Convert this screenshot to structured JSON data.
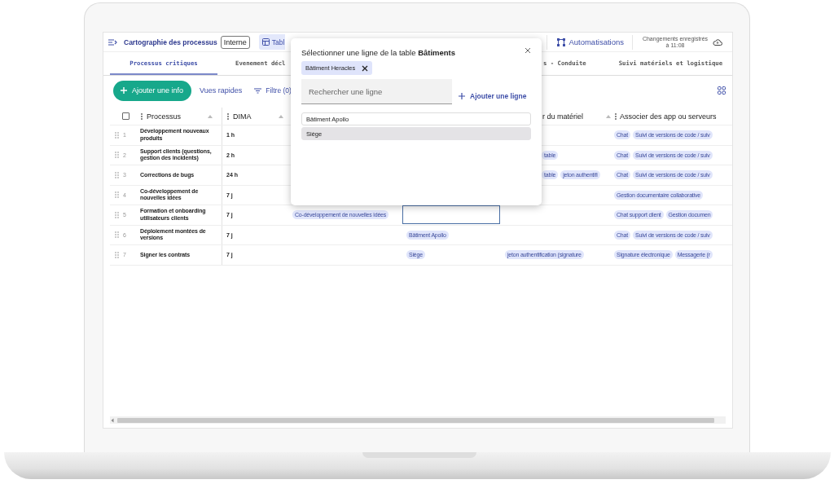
{
  "topbar": {
    "title": "Cartographie des processus",
    "badge": "Interne",
    "view_tab": "Tabl",
    "automations_tab": "Automatisations",
    "save_status": "Changements enregistrés à 11:08"
  },
  "tabs": [
    {
      "label": "Processus critiques",
      "selected": true
    },
    {
      "label": "Evenement décl",
      "selected": false
    },
    {
      "label": "s - Conduite",
      "selected": false
    },
    {
      "label": "Suivi matériels et logistique",
      "selected": false
    }
  ],
  "toolbar": {
    "add_button": "Ajouter une info",
    "quick_views": "Vues rapides",
    "filter": "Filtre (0)"
  },
  "table": {
    "select_all_checked": false,
    "header": {
      "processus": "Processus",
      "dima": "DIMA",
      "column_5": "r du matériel",
      "column_6": "Associer des app ou serveurs"
    },
    "rows": [
      {
        "number": "1",
        "processus": "Développement nouveaux produits",
        "dima": "1 h",
        "column_3": [],
        "column_4": [],
        "column_4_editing": false,
        "column_5": [],
        "column_6": [
          "Chat",
          "Suivi de versions de code / suiv"
        ]
      },
      {
        "number": "2",
        "processus": "Support clients (questions, gestion des incidents)",
        "dima": "2 h",
        "column_3": [],
        "column_4": [],
        "column_4_editing": false,
        "column_5": [
          "table"
        ],
        "column_6": [
          "Chat",
          "Suivi de versions de code / suiv"
        ]
      },
      {
        "number": "3",
        "processus": "Corrections de bugs",
        "dima": "24 h",
        "column_3": [],
        "column_4": [],
        "column_4_editing": false,
        "column_5": [
          "table",
          "jeton authentifi"
        ],
        "column_6": [
          "Chat",
          "Suivi de versions de code / suiv"
        ]
      },
      {
        "number": "4",
        "processus": "Co-développement de nouvelles idées",
        "dima": "7 j",
        "column_3": [],
        "column_4": [],
        "column_4_editing": false,
        "column_5": [],
        "column_6": [
          "Gestion documentaire collaborative"
        ]
      },
      {
        "number": "5",
        "processus": "Formation et onboarding utilisateurs clients",
        "dima": "7 j",
        "column_3": [
          "Co-développement de nouvelles idées"
        ],
        "column_4": [],
        "column_4_editing": true,
        "column_5": [],
        "column_6": [
          "Chat support client",
          "Gestion documen"
        ]
      },
      {
        "number": "6",
        "processus": "Déploiement montées de versions",
        "dima": "7 j",
        "column_3": [],
        "column_4": [
          "Bâtiment Apollo"
        ],
        "column_4_editing": false,
        "column_5": [],
        "column_6": [
          "Chat",
          "Suivi de versions de code / suiv"
        ]
      },
      {
        "number": "7",
        "processus": "Signer les contrats",
        "dima": "7 j",
        "column_3": [],
        "column_4": [
          "Siège"
        ],
        "column_4_editing": false,
        "column_5": [
          "jeton authentification (signature"
        ],
        "column_6": [
          "Signature électronique",
          "Messagerie (r"
        ]
      }
    ]
  },
  "dialog": {
    "title": "Sélectionner une ligne de la table **Bâtiments**",
    "selected_chip": "Bâtiment Heracles",
    "search": {
      "placeholder": "Rechercher une ligne"
    },
    "add_link": "Ajouter une ligne",
    "options": [
      {
        "label": "Bâtiment Apollo",
        "highlighted": false
      },
      {
        "label": "Siège",
        "highlighted": true
      }
    ]
  }
}
